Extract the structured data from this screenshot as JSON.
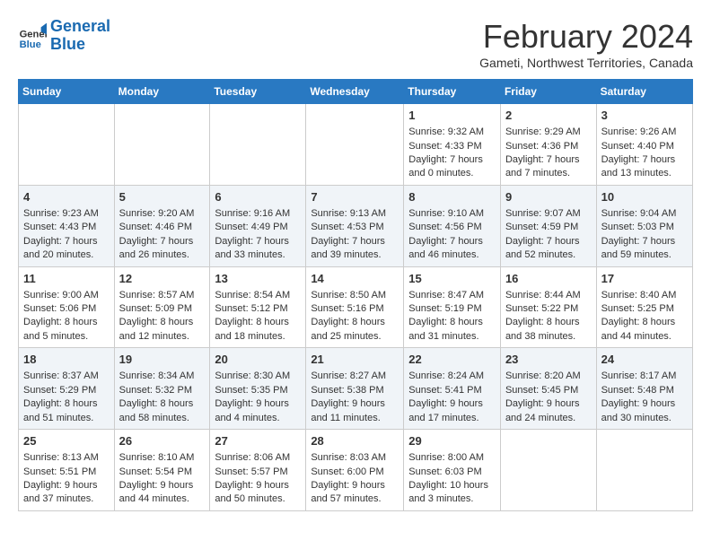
{
  "header": {
    "logo_line1": "General",
    "logo_line2": "Blue",
    "month_title": "February 2024",
    "subtitle": "Gameti, Northwest Territories, Canada"
  },
  "days_of_week": [
    "Sunday",
    "Monday",
    "Tuesday",
    "Wednesday",
    "Thursday",
    "Friday",
    "Saturday"
  ],
  "weeks": [
    [
      {
        "day": "",
        "content": ""
      },
      {
        "day": "",
        "content": ""
      },
      {
        "day": "",
        "content": ""
      },
      {
        "day": "",
        "content": ""
      },
      {
        "day": "1",
        "content": "Sunrise: 9:32 AM\nSunset: 4:33 PM\nDaylight: 7 hours\nand 0 minutes."
      },
      {
        "day": "2",
        "content": "Sunrise: 9:29 AM\nSunset: 4:36 PM\nDaylight: 7 hours\nand 7 minutes."
      },
      {
        "day": "3",
        "content": "Sunrise: 9:26 AM\nSunset: 4:40 PM\nDaylight: 7 hours\nand 13 minutes."
      }
    ],
    [
      {
        "day": "4",
        "content": "Sunrise: 9:23 AM\nSunset: 4:43 PM\nDaylight: 7 hours\nand 20 minutes."
      },
      {
        "day": "5",
        "content": "Sunrise: 9:20 AM\nSunset: 4:46 PM\nDaylight: 7 hours\nand 26 minutes."
      },
      {
        "day": "6",
        "content": "Sunrise: 9:16 AM\nSunset: 4:49 PM\nDaylight: 7 hours\nand 33 minutes."
      },
      {
        "day": "7",
        "content": "Sunrise: 9:13 AM\nSunset: 4:53 PM\nDaylight: 7 hours\nand 39 minutes."
      },
      {
        "day": "8",
        "content": "Sunrise: 9:10 AM\nSunset: 4:56 PM\nDaylight: 7 hours\nand 46 minutes."
      },
      {
        "day": "9",
        "content": "Sunrise: 9:07 AM\nSunset: 4:59 PM\nDaylight: 7 hours\nand 52 minutes."
      },
      {
        "day": "10",
        "content": "Sunrise: 9:04 AM\nSunset: 5:03 PM\nDaylight: 7 hours\nand 59 minutes."
      }
    ],
    [
      {
        "day": "11",
        "content": "Sunrise: 9:00 AM\nSunset: 5:06 PM\nDaylight: 8 hours\nand 5 minutes."
      },
      {
        "day": "12",
        "content": "Sunrise: 8:57 AM\nSunset: 5:09 PM\nDaylight: 8 hours\nand 12 minutes."
      },
      {
        "day": "13",
        "content": "Sunrise: 8:54 AM\nSunset: 5:12 PM\nDaylight: 8 hours\nand 18 minutes."
      },
      {
        "day": "14",
        "content": "Sunrise: 8:50 AM\nSunset: 5:16 PM\nDaylight: 8 hours\nand 25 minutes."
      },
      {
        "day": "15",
        "content": "Sunrise: 8:47 AM\nSunset: 5:19 PM\nDaylight: 8 hours\nand 31 minutes."
      },
      {
        "day": "16",
        "content": "Sunrise: 8:44 AM\nSunset: 5:22 PM\nDaylight: 8 hours\nand 38 minutes."
      },
      {
        "day": "17",
        "content": "Sunrise: 8:40 AM\nSunset: 5:25 PM\nDaylight: 8 hours\nand 44 minutes."
      }
    ],
    [
      {
        "day": "18",
        "content": "Sunrise: 8:37 AM\nSunset: 5:29 PM\nDaylight: 8 hours\nand 51 minutes."
      },
      {
        "day": "19",
        "content": "Sunrise: 8:34 AM\nSunset: 5:32 PM\nDaylight: 8 hours\nand 58 minutes."
      },
      {
        "day": "20",
        "content": "Sunrise: 8:30 AM\nSunset: 5:35 PM\nDaylight: 9 hours\nand 4 minutes."
      },
      {
        "day": "21",
        "content": "Sunrise: 8:27 AM\nSunset: 5:38 PM\nDaylight: 9 hours\nand 11 minutes."
      },
      {
        "day": "22",
        "content": "Sunrise: 8:24 AM\nSunset: 5:41 PM\nDaylight: 9 hours\nand 17 minutes."
      },
      {
        "day": "23",
        "content": "Sunrise: 8:20 AM\nSunset: 5:45 PM\nDaylight: 9 hours\nand 24 minutes."
      },
      {
        "day": "24",
        "content": "Sunrise: 8:17 AM\nSunset: 5:48 PM\nDaylight: 9 hours\nand 30 minutes."
      }
    ],
    [
      {
        "day": "25",
        "content": "Sunrise: 8:13 AM\nSunset: 5:51 PM\nDaylight: 9 hours\nand 37 minutes."
      },
      {
        "day": "26",
        "content": "Sunrise: 8:10 AM\nSunset: 5:54 PM\nDaylight: 9 hours\nand 44 minutes."
      },
      {
        "day": "27",
        "content": "Sunrise: 8:06 AM\nSunset: 5:57 PM\nDaylight: 9 hours\nand 50 minutes."
      },
      {
        "day": "28",
        "content": "Sunrise: 8:03 AM\nSunset: 6:00 PM\nDaylight: 9 hours\nand 57 minutes."
      },
      {
        "day": "29",
        "content": "Sunrise: 8:00 AM\nSunset: 6:03 PM\nDaylight: 10 hours\nand 3 minutes."
      },
      {
        "day": "",
        "content": ""
      },
      {
        "day": "",
        "content": ""
      }
    ]
  ]
}
